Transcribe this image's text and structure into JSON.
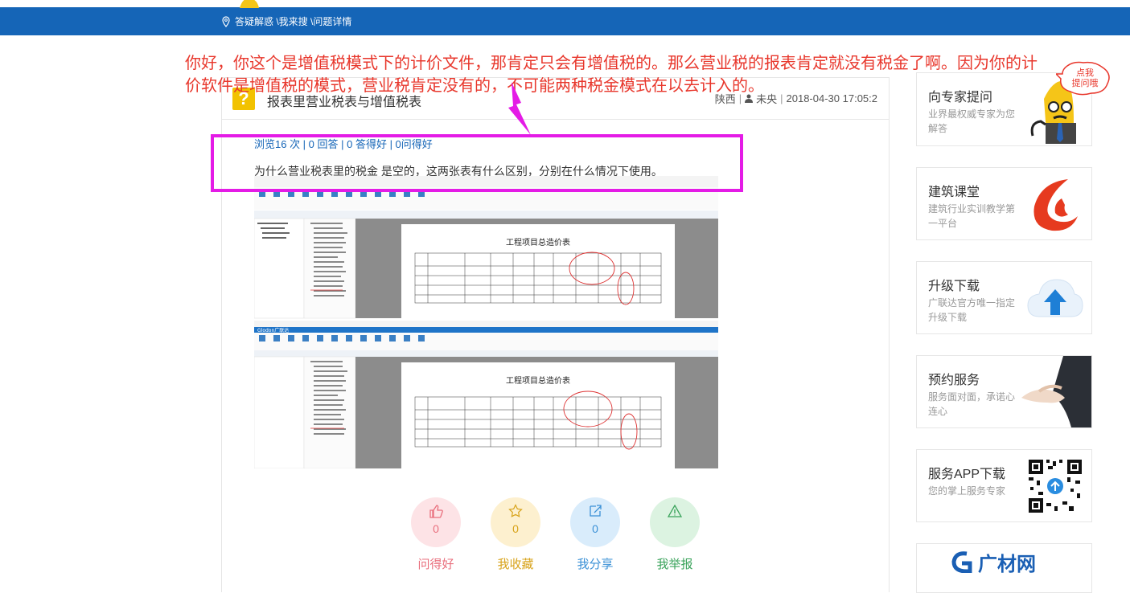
{
  "breadcrumb": {
    "text": "答疑解惑 \\我来搜 \\问题详情"
  },
  "question": {
    "title": "报表里营业税表与增值税表",
    "region": "陕西",
    "user": "未央",
    "datetime": "2018-04-30 17:05:2",
    "stats": "浏览16 次 | 0 回答 | 0 答得好 | 0问得好",
    "description": "为什么营业税表里的税金 是空的，这两张表有什么区别，分别在什么情况下使用。"
  },
  "screenshot_report_title": "工程项目总造价表",
  "actions": [
    {
      "label": "问得好",
      "count": "0",
      "icon": "thumbs-up-icon",
      "color": "#e96f7d",
      "bg": "#fde3e6"
    },
    {
      "label": "我收藏",
      "count": "0",
      "icon": "star-icon",
      "color": "#d8a31a",
      "bg": "#fdf0cf"
    },
    {
      "label": "我分享",
      "count": "0",
      "icon": "share-icon",
      "color": "#3a90d6",
      "bg": "#d9ecfb"
    },
    {
      "label": "我举报",
      "count": "",
      "icon": "warning-icon",
      "color": "#3aa35b",
      "bg": "#dcf3e1"
    }
  ],
  "annotation": {
    "text": "你好，你这个是增值税模式下的计价文件，那肯定只会有增值税的。那么营业税的报表肯定就没有税金了啊。因为你的计价软件是增值税的模式，营业税肯定没有的，不可能两种税金模式在以去计入的。",
    "color": "#e8372c",
    "box_color": "#e41be6"
  },
  "sidebar": [
    {
      "title": "向专家提问",
      "sub": "业界最权威专家为您解答",
      "icon": "expert-mascot-icon"
    },
    {
      "title": "建筑课堂",
      "sub": "建筑行业实训教学第一平台",
      "icon": "course-logo-icon"
    },
    {
      "title": "升级下载",
      "sub": "广联达官方唯一指定升级下载",
      "icon": "cloud-upload-icon"
    },
    {
      "title": "预约服务",
      "sub": "服务面对面，承诺心连心",
      "icon": "handshake-icon"
    },
    {
      "title": "服务APP下载",
      "sub": "您的掌上服务专家",
      "icon": "qr-code-icon"
    },
    {
      "title": "",
      "sub": "",
      "icon": "guangcai-logo-icon",
      "logo_text": "G广材网"
    }
  ],
  "ask_bubble": "点我提问哦",
  "colors": {
    "nav": "#1565b7",
    "link": "#1565b7"
  }
}
